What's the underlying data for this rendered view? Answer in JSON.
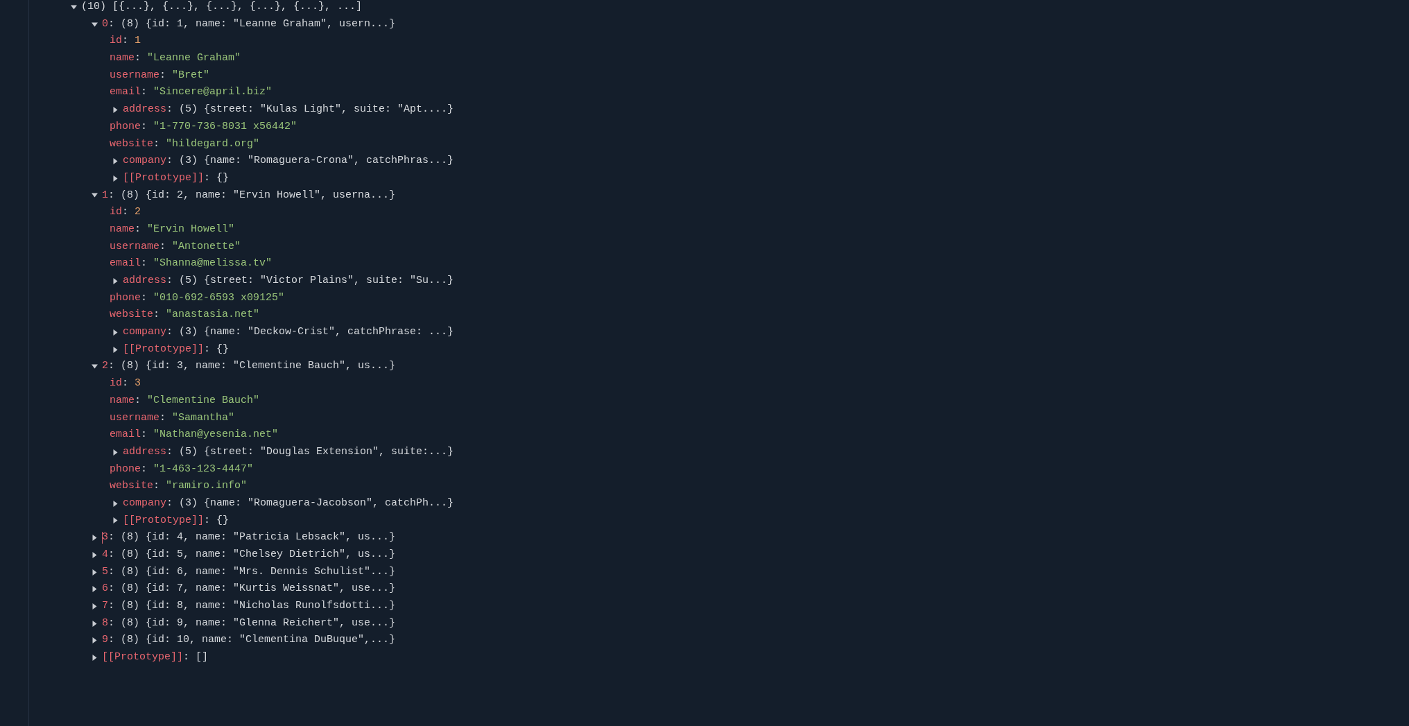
{
  "console": {
    "root": {
      "summary": "(10) [{...}, {...}, {...}, {...}, {...}, ...]",
      "kind": "object",
      "expanded": true,
      "children": [
        {
          "key": "0",
          "sep": ":",
          "kind": "object",
          "summary": "(8) {id: 1, name: \"Leanne Graham\", usern...}",
          "expanded": true,
          "children": [
            {
              "key": "id",
              "sep": ":",
              "kind": "number",
              "value": "1"
            },
            {
              "key": "name",
              "sep": ":",
              "kind": "string",
              "value": "\"Leanne Graham\""
            },
            {
              "key": "username",
              "sep": ":",
              "kind": "string",
              "value": "\"Bret\""
            },
            {
              "key": "email",
              "sep": ":",
              "kind": "string",
              "value": "\"Sincere@april.biz\""
            },
            {
              "key": "address",
              "sep": ":",
              "kind": "object",
              "summary": "(5) {street: \"Kulas Light\", suite: \"Apt....}",
              "expanded": false
            },
            {
              "key": "phone",
              "sep": ":",
              "kind": "string",
              "value": "\"1-770-736-8031 x56442\""
            },
            {
              "key": "website",
              "sep": ":",
              "kind": "string",
              "value": "\"hildegard.org\""
            },
            {
              "key": "company",
              "sep": ":",
              "kind": "object",
              "summary": "(3) {name: \"Romaguera-Crona\", catchPhras...}",
              "expanded": false
            },
            {
              "key": "[[Prototype]]",
              "sep": ":",
              "kind": "object",
              "summary": "{}",
              "expanded": false
            }
          ]
        },
        {
          "key": "1",
          "sep": ":",
          "kind": "object",
          "summary": "(8) {id: 2, name: \"Ervin Howell\", userna...}",
          "expanded": true,
          "children": [
            {
              "key": "id",
              "sep": ":",
              "kind": "number",
              "value": "2"
            },
            {
              "key": "name",
              "sep": ":",
              "kind": "string",
              "value": "\"Ervin Howell\""
            },
            {
              "key": "username",
              "sep": ":",
              "kind": "string",
              "value": "\"Antonette\""
            },
            {
              "key": "email",
              "sep": ":",
              "kind": "string",
              "value": "\"Shanna@melissa.tv\""
            },
            {
              "key": "address",
              "sep": ":",
              "kind": "object",
              "summary": "(5) {street: \"Victor Plains\", suite: \"Su...}",
              "expanded": false
            },
            {
              "key": "phone",
              "sep": ":",
              "kind": "string",
              "value": "\"010-692-6593 x09125\""
            },
            {
              "key": "website",
              "sep": ":",
              "kind": "string",
              "value": "\"anastasia.net\""
            },
            {
              "key": "company",
              "sep": ":",
              "kind": "object",
              "summary": "(3) {name: \"Deckow-Crist\", catchPhrase: ...}",
              "expanded": false
            },
            {
              "key": "[[Prototype]]",
              "sep": ":",
              "kind": "object",
              "summary": "{}",
              "expanded": false
            }
          ]
        },
        {
          "key": "2",
          "sep": ":",
          "kind": "object",
          "summary": "(8) {id: 3, name: \"Clementine Bauch\", us...}",
          "expanded": true,
          "children": [
            {
              "key": "id",
              "sep": ":",
              "kind": "number",
              "value": "3"
            },
            {
              "key": "name",
              "sep": ":",
              "kind": "string",
              "value": "\"Clementine Bauch\""
            },
            {
              "key": "username",
              "sep": ":",
              "kind": "string",
              "value": "\"Samantha\""
            },
            {
              "key": "email",
              "sep": ":",
              "kind": "string",
              "value": "\"Nathan@yesenia.net\""
            },
            {
              "key": "address",
              "sep": ":",
              "kind": "object",
              "summary": "(5) {street: \"Douglas Extension\", suite:...}",
              "expanded": false
            },
            {
              "key": "phone",
              "sep": ":",
              "kind": "string",
              "value": "\"1-463-123-4447\""
            },
            {
              "key": "website",
              "sep": ":",
              "kind": "string",
              "value": "\"ramiro.info\""
            },
            {
              "key": "company",
              "sep": ":",
              "kind": "object",
              "summary": "(3) {name: \"Romaguera-Jacobson\", catchPh...}",
              "expanded": false
            },
            {
              "key": "[[Prototype]]",
              "sep": ":",
              "kind": "object",
              "summary": "{}",
              "expanded": false
            }
          ]
        },
        {
          "key": "3",
          "sep": ":",
          "kind": "object",
          "summary": "(8) {id: 4, name: \"Patricia Lebsack\", us...}",
          "expanded": false,
          "cursor": true
        },
        {
          "key": "4",
          "sep": ":",
          "kind": "object",
          "summary": "(8) {id: 5, name: \"Chelsey Dietrich\", us...}",
          "expanded": false
        },
        {
          "key": "5",
          "sep": ":",
          "kind": "object",
          "summary": "(8) {id: 6, name: \"Mrs. Dennis Schulist\"...}",
          "expanded": false
        },
        {
          "key": "6",
          "sep": ":",
          "kind": "object",
          "summary": "(8) {id: 7, name: \"Kurtis Weissnat\", use...}",
          "expanded": false
        },
        {
          "key": "7",
          "sep": ":",
          "kind": "object",
          "summary": "(8) {id: 8, name: \"Nicholas Runolfsdotti...}",
          "expanded": false
        },
        {
          "key": "8",
          "sep": ":",
          "kind": "object",
          "summary": "(8) {id: 9, name: \"Glenna Reichert\", use...}",
          "expanded": false
        },
        {
          "key": "9",
          "sep": ":",
          "kind": "object",
          "summary": "(8) {id: 10, name: \"Clementina DuBuque\",...}",
          "expanded": false
        },
        {
          "key": "[[Prototype]]",
          "sep": ":",
          "kind": "object",
          "summary": "[]",
          "expanded": false
        }
      ]
    }
  }
}
